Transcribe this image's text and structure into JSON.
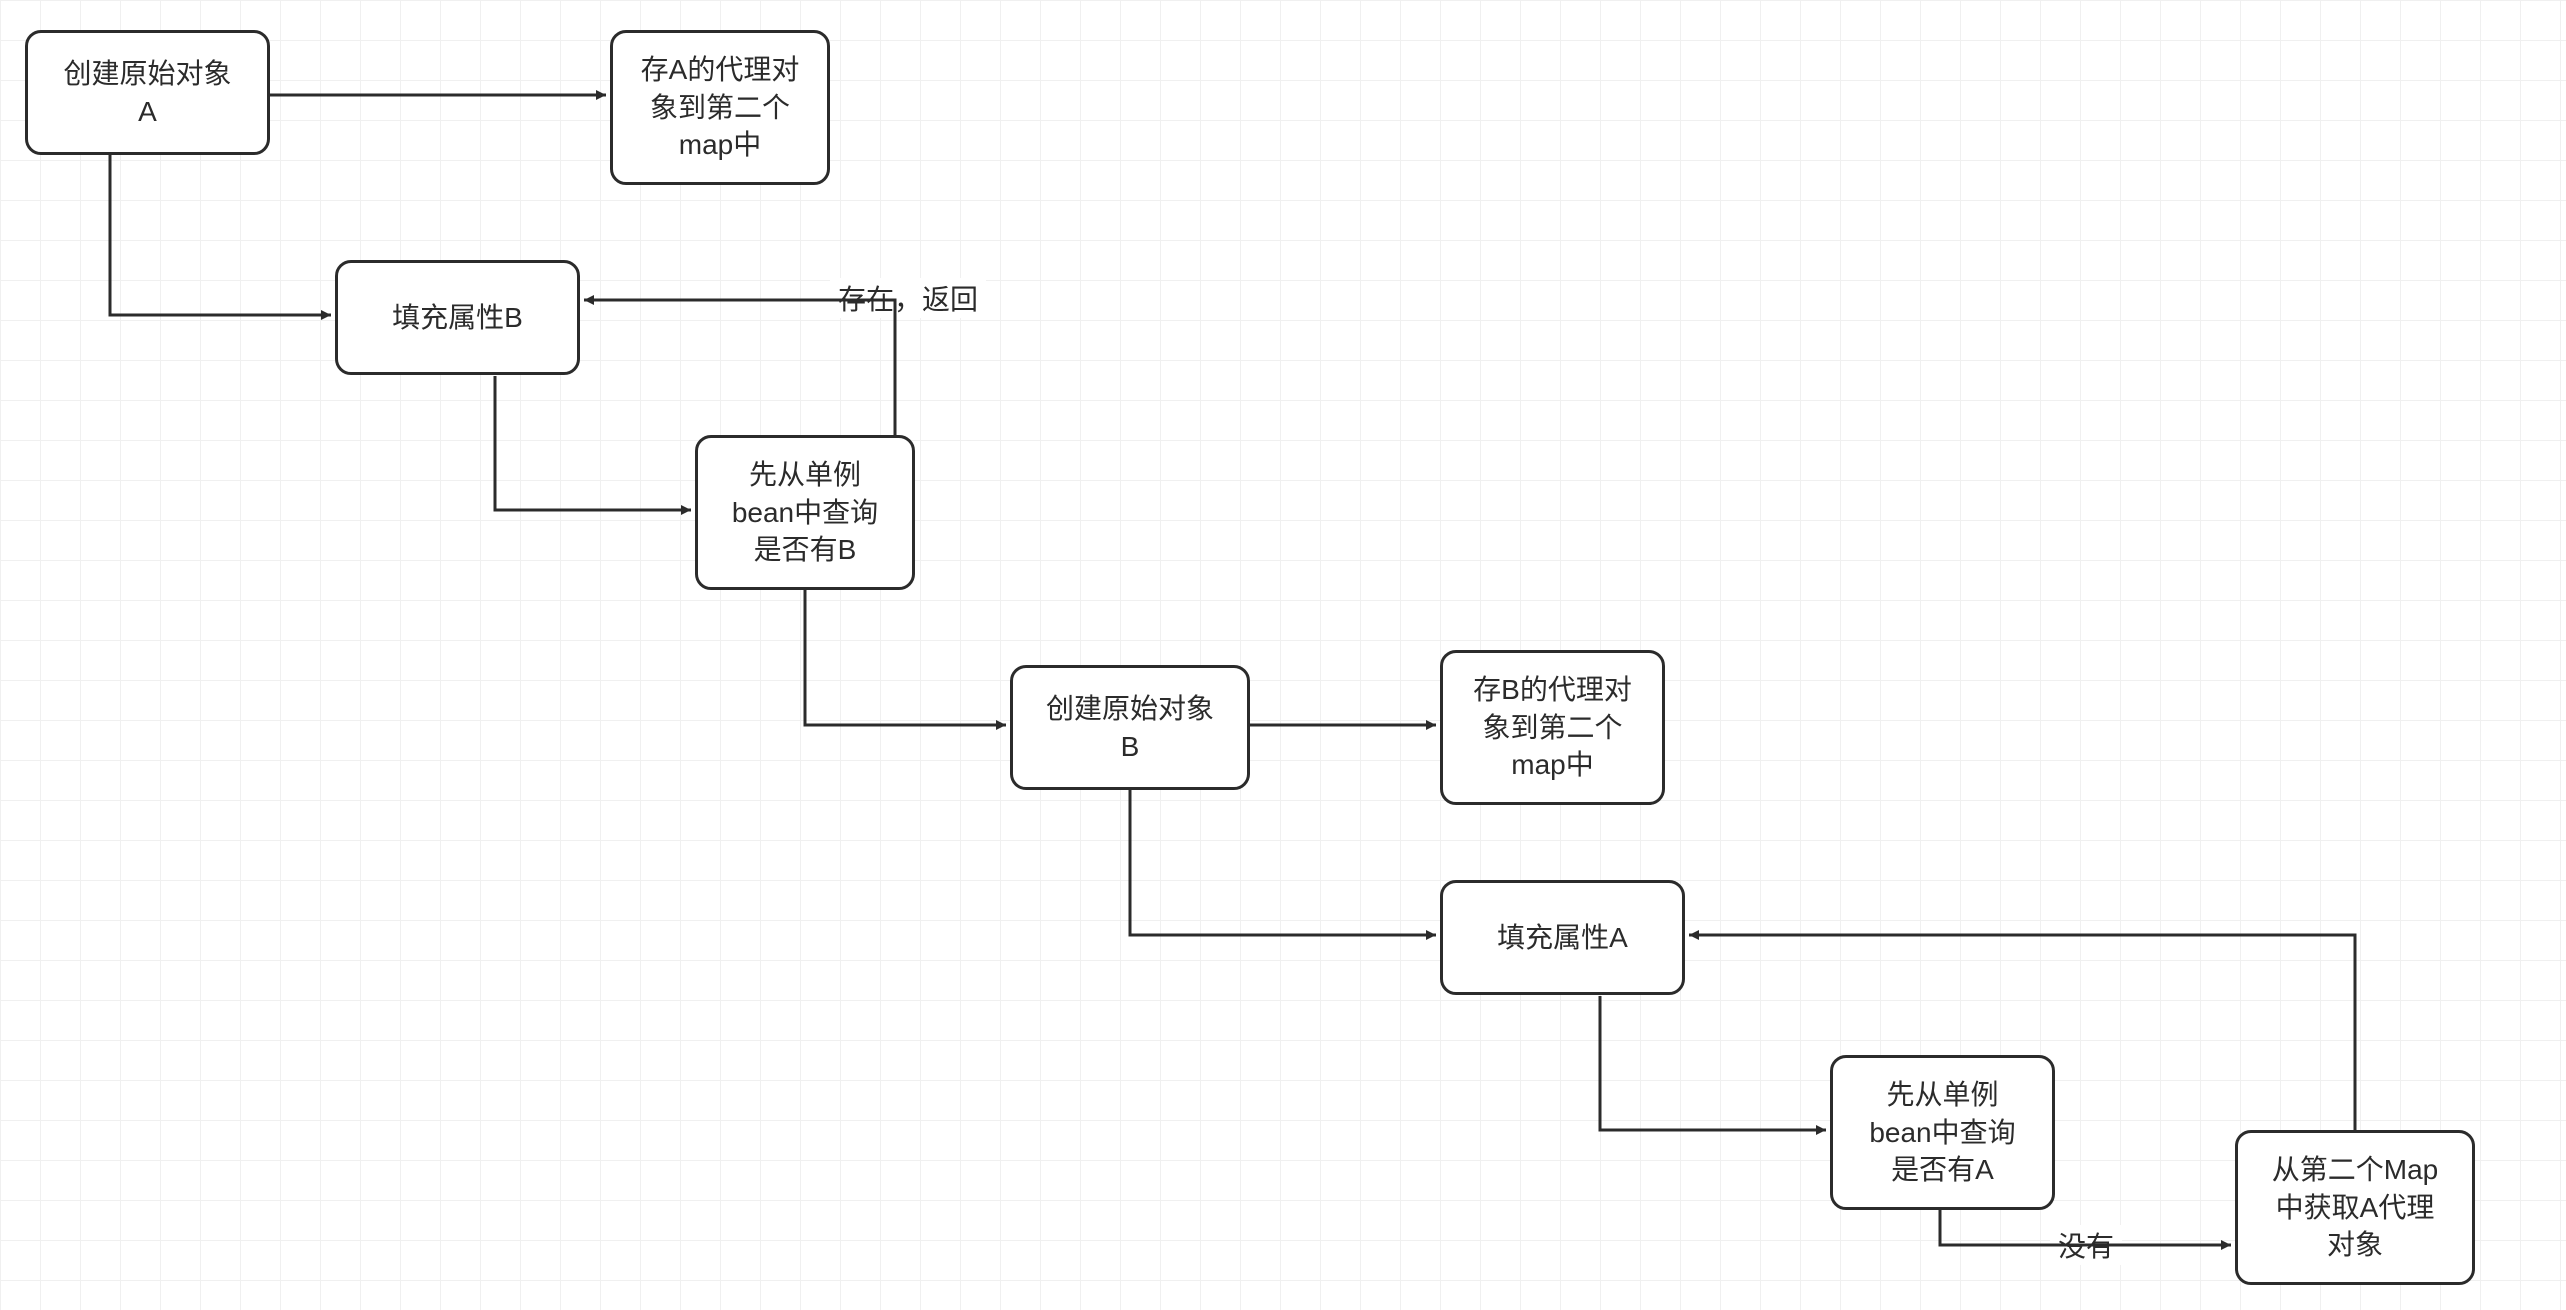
{
  "diagram": {
    "type": "flowchart",
    "nodes": {
      "n1": {
        "label": "创建原始对象\nA"
      },
      "n2": {
        "label": "存A的代理对\n象到第二个\nmap中"
      },
      "n3": {
        "label": "填充属性B"
      },
      "n4": {
        "label": "先从单例\nbean中查询\n是否有B"
      },
      "n5": {
        "label": "创建原始对象\nB"
      },
      "n6": {
        "label": "存B的代理对\n象到第二个\nmap中"
      },
      "n7": {
        "label": "填充属性A"
      },
      "n8": {
        "label": "先从单例\nbean中查询\n是否有A"
      },
      "n9": {
        "label": "从第二个Map\n中获取A代理\n对象"
      }
    },
    "edges": [
      {
        "from": "n1",
        "to": "n2",
        "label": null
      },
      {
        "from": "n1",
        "to": "n3",
        "label": null
      },
      {
        "from": "n3",
        "to": "n4",
        "label": null
      },
      {
        "from": "n4",
        "to": "n3",
        "label": "存在，返回"
      },
      {
        "from": "n4",
        "to": "n5",
        "label": null
      },
      {
        "from": "n5",
        "to": "n6",
        "label": null
      },
      {
        "from": "n5",
        "to": "n7",
        "label": null
      },
      {
        "from": "n7",
        "to": "n8",
        "label": null
      },
      {
        "from": "n8",
        "to": "n9",
        "label": "没有"
      },
      {
        "from": "n9",
        "to": "n7",
        "label": null
      }
    ],
    "edge_labels": {
      "e_exists": "存在，返回",
      "e_none": "没有"
    }
  }
}
